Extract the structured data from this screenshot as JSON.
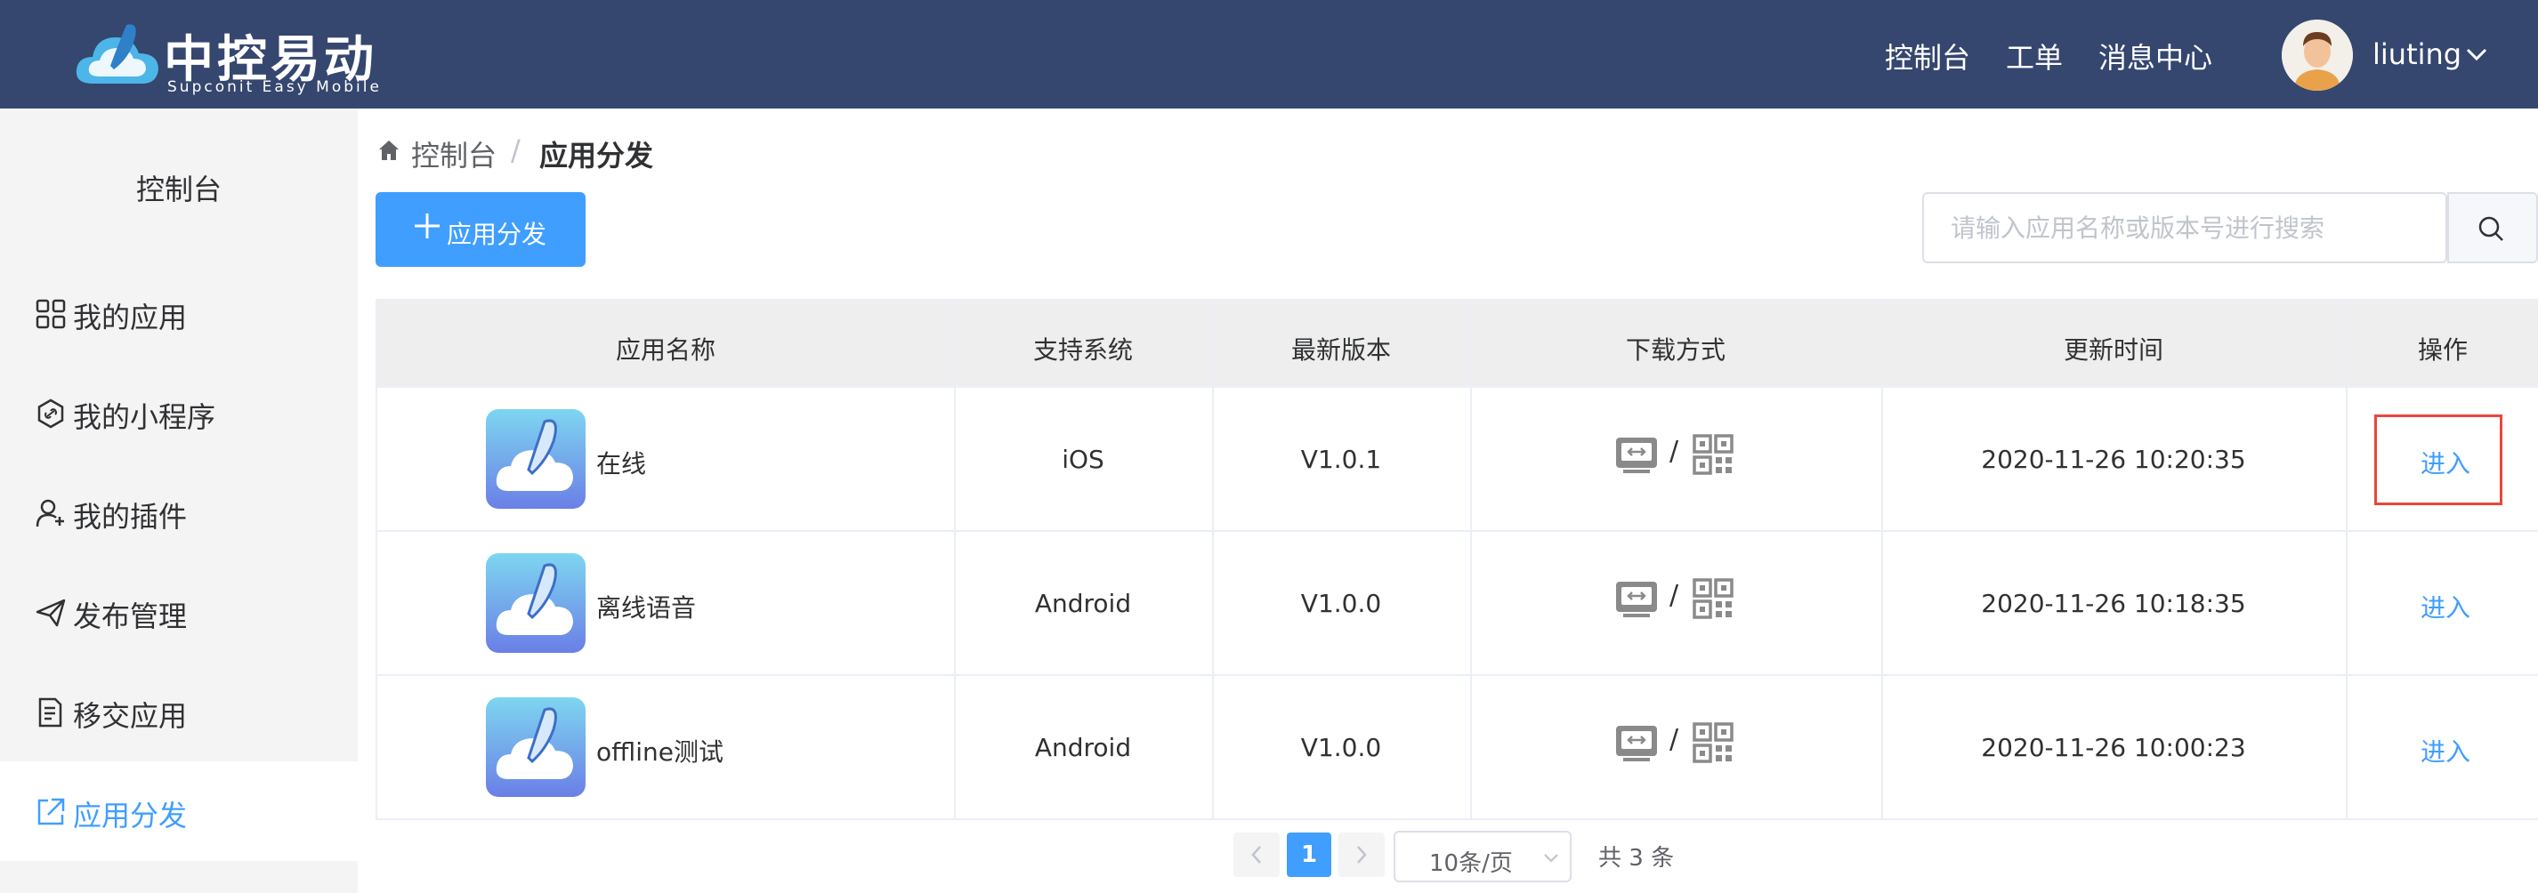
{
  "header": {
    "logo_title": "中控易动",
    "logo_subtitle": "Supconit Easy Mobile",
    "nav": [
      "控制台",
      "工单",
      "消息中心"
    ],
    "username": "liuting"
  },
  "sidebar": {
    "title": "控制台",
    "items": [
      {
        "label": "我的应用",
        "icon": "grid-icon"
      },
      {
        "label": "我的小程序",
        "icon": "hexagon-link-icon"
      },
      {
        "label": "我的插件",
        "icon": "user-plugin-icon"
      },
      {
        "label": "发布管理",
        "icon": "paper-plane-icon"
      },
      {
        "label": "移交应用",
        "icon": "document-transfer-icon"
      },
      {
        "label": "应用分发",
        "icon": "external-link-icon",
        "active": true
      }
    ]
  },
  "breadcrumb": {
    "home": "控制台",
    "separator": "/",
    "current": "应用分发"
  },
  "toolbar": {
    "add_label": "应用分发",
    "search_placeholder": "请输入应用名称或版本号进行搜索"
  },
  "table": {
    "columns": [
      "应用名称",
      "支持系统",
      "最新版本",
      "下载方式",
      "更新时间",
      "操作"
    ],
    "rows": [
      {
        "name": "在线",
        "system": "iOS",
        "version": "V1.0.1",
        "slash": "/",
        "updated": "2020-11-26 10:20:35",
        "action": "进入",
        "highlighted": true
      },
      {
        "name": "离线语音",
        "system": "Android",
        "version": "V1.0.0",
        "slash": "/",
        "updated": "2020-11-26 10:18:35",
        "action": "进入"
      },
      {
        "name": "offline测试",
        "system": "Android",
        "version": "V1.0.0",
        "slash": "/",
        "updated": "2020-11-26 10:00:23",
        "action": "进入"
      }
    ]
  },
  "pagination": {
    "current_page": "1",
    "page_size": "10条/页",
    "total": "共 3 条"
  },
  "colors": {
    "header_bg": "#35466f",
    "primary": "#409eff",
    "highlight_border": "#e8473a",
    "sidebar_bg": "#f4f4f5"
  }
}
